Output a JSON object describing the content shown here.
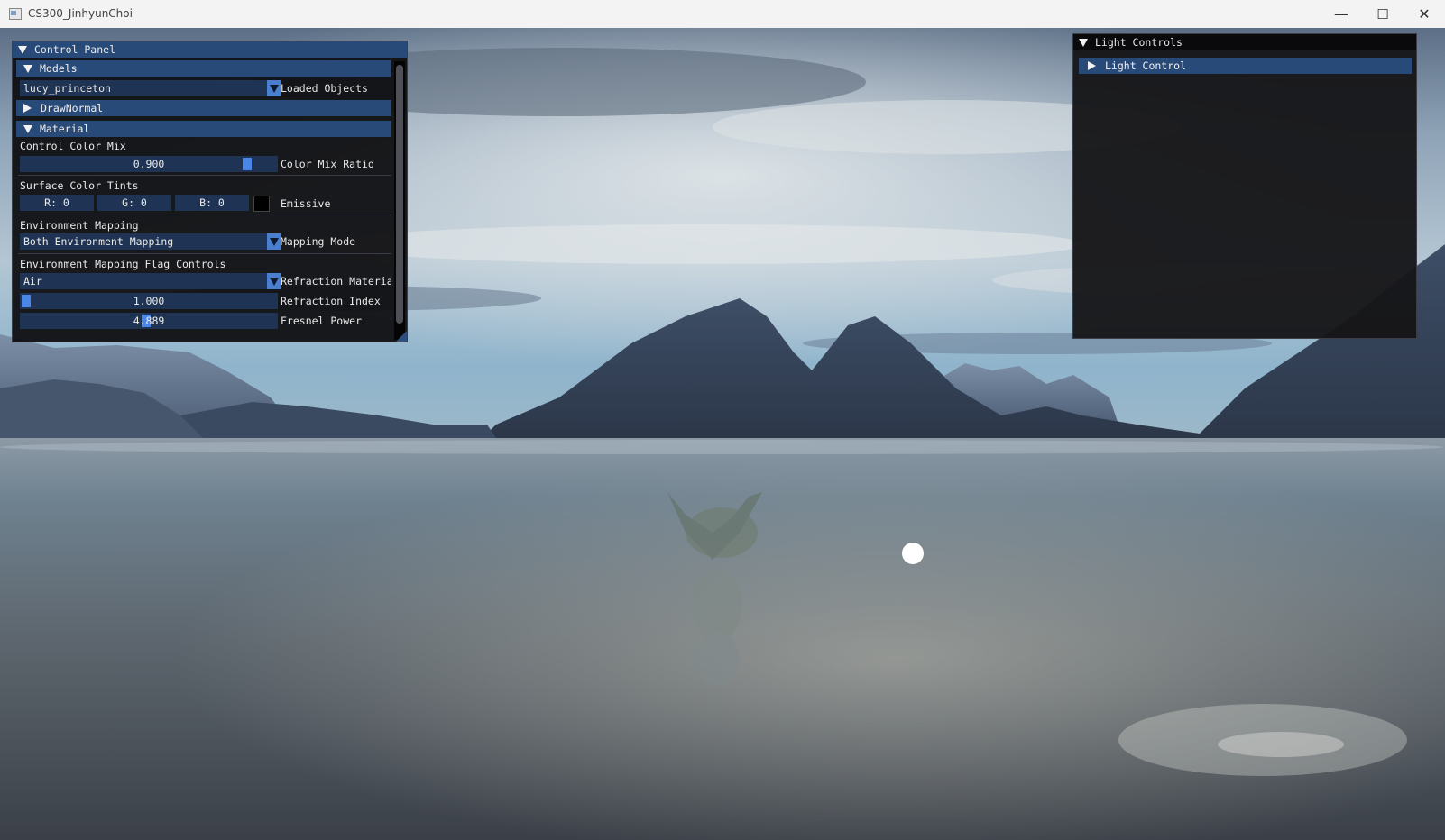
{
  "window": {
    "title": "CS300_JinhyunChoi",
    "minimize_glyph": "—",
    "maximize_glyph": "☐",
    "close_glyph": "✕"
  },
  "control_panel": {
    "title": "Control Panel",
    "models_header": "Models",
    "model_combo_value": "lucy_princeton",
    "model_combo_label": "Loaded Objects",
    "drawnormal_header": "DrawNormal",
    "material_header": "Material",
    "color_mix_section": "Control Color Mix",
    "color_mix_value": "0.900",
    "color_mix_fraction": 0.9,
    "color_mix_label": "Color Mix Ratio",
    "surface_tints_section": "Surface Color Tints",
    "tint_r": "R:  0",
    "tint_g": "G:  0",
    "tint_b": "B:  0",
    "emissive_label": "Emissive",
    "env_mapping_section": "Environment Mapping",
    "mapping_mode_value": "Both Environment Mapping",
    "mapping_mode_label": "Mapping Mode",
    "env_flags_section": "Environment Mapping Flag Controls",
    "refraction_material_value": "Air",
    "refraction_material_label": "Refraction Materia",
    "refraction_index_value": "1.000",
    "refraction_index_fraction": 0.0,
    "refraction_index_label": "Refraction Index",
    "fresnel_value": "4.889",
    "fresnel_fraction": 0.49,
    "fresnel_label": "Fresnel Power"
  },
  "light_controls": {
    "title": "Light Controls",
    "light_control_header": "Light Control"
  },
  "colors": {
    "header_bg": "#284a79",
    "frame_bg": "#1f3454",
    "grab": "#4a86e6",
    "combo_button": "#4a7fd0"
  }
}
